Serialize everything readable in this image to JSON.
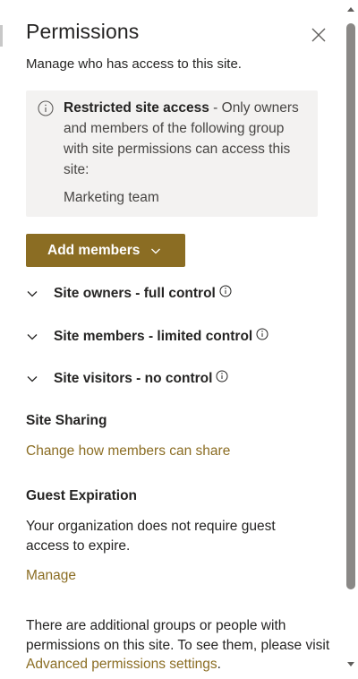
{
  "panel": {
    "title": "Permissions",
    "subtitle": "Manage who has access to this site."
  },
  "info_box": {
    "bold": "Restricted site access",
    "text": " - Only owners and members of the following group with site permissions can access this site:",
    "group": "Marketing team"
  },
  "add_members": {
    "label": "Add members"
  },
  "groups": [
    {
      "label": "Site owners - full control"
    },
    {
      "label": "Site members - limited control"
    },
    {
      "label": "Site visitors - no control"
    }
  ],
  "site_sharing": {
    "heading": "Site Sharing",
    "link": "Change how members can share"
  },
  "guest_expiration": {
    "heading": "Guest Expiration",
    "text": "Your organization does not require guest access to expire.",
    "link": "Manage"
  },
  "footer": {
    "text": "There are additional groups or people with permissions on this site. To see them, please visit ",
    "link": "Advanced permissions settings",
    "suffix": "."
  },
  "colors": {
    "accent": "#8b6d23",
    "info_bg": "#f3f2f1",
    "text": "#252423"
  },
  "icons": [
    "close-icon",
    "info-icon",
    "chevron-down-icon",
    "scroll-up-icon",
    "scroll-down-icon"
  ]
}
